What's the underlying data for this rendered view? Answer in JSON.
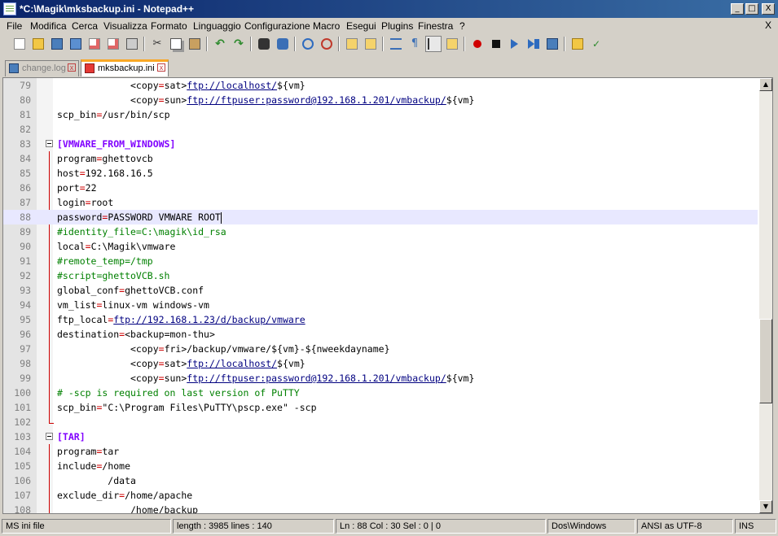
{
  "window": {
    "title": "*C:\\Magik\\mksbackup.ini - Notepad++",
    "minimize": "_",
    "maximize": "□",
    "close": "X"
  },
  "menu": {
    "items": [
      "File",
      "Modifica",
      "Cerca",
      "Visualizza",
      "Formato",
      "Linguaggio",
      "Configurazione",
      "Macro",
      "Esegui",
      "Plugins",
      "Finestra",
      "?"
    ],
    "close_doc": "X"
  },
  "toolbar": {
    "icons": [
      "new-file-icon",
      "open-file-icon",
      "save-icon",
      "save-all-icon",
      "close-icon",
      "close-all-icon",
      "print-icon",
      "cut-icon",
      "copy-icon",
      "paste-icon",
      "undo-icon",
      "redo-icon",
      "find-icon",
      "replace-icon",
      "zoom-in-icon",
      "zoom-out-icon",
      "sync-vertical-icon",
      "sync-horizontal-icon",
      "word-wrap-icon",
      "show-all-chars-icon",
      "indent-guide-icon",
      "user-language-icon",
      "record-macro-icon",
      "stop-record-icon",
      "play-macro-icon",
      "play-multiple-icon",
      "save-macro-icon",
      "open-folder-icon",
      "spellcheck-icon"
    ]
  },
  "tabs": [
    {
      "label": "change.log",
      "active": false
    },
    {
      "label": "mksbackup.ini",
      "active": true
    }
  ],
  "editor": {
    "current_line": 88,
    "lines": [
      {
        "n": "79",
        "parts": [
          [
            "val",
            "             <copy"
          ],
          [
            "eq",
            "="
          ],
          [
            "val",
            "sat>"
          ],
          [
            "link",
            "ftp://localhost/"
          ],
          [
            "val",
            "${vm}"
          ]
        ]
      },
      {
        "n": "80",
        "parts": [
          [
            "val",
            "             <copy"
          ],
          [
            "eq",
            "="
          ],
          [
            "val",
            "sun>"
          ],
          [
            "link",
            "ftp://ftpuser:password@192.168.1.201/vmbackup/"
          ],
          [
            "val",
            "${vm}"
          ]
        ]
      },
      {
        "n": "81",
        "parts": [
          [
            "key",
            "scp_bin"
          ],
          [
            "eq",
            "="
          ],
          [
            "val",
            "/usr/bin/scp"
          ]
        ]
      },
      {
        "n": "82",
        "parts": []
      },
      {
        "n": "83",
        "parts": [
          [
            "section",
            "[VMWARE_FROM_WINDOWS]"
          ]
        ]
      },
      {
        "n": "84",
        "parts": [
          [
            "key",
            "program"
          ],
          [
            "eq",
            "="
          ],
          [
            "val",
            "ghettovcb"
          ]
        ]
      },
      {
        "n": "85",
        "parts": [
          [
            "key",
            "host"
          ],
          [
            "eq",
            "="
          ],
          [
            "val",
            "192.168.16.5"
          ]
        ]
      },
      {
        "n": "86",
        "parts": [
          [
            "key",
            "port"
          ],
          [
            "eq",
            "="
          ],
          [
            "val",
            "22"
          ]
        ]
      },
      {
        "n": "87",
        "parts": [
          [
            "key",
            "login"
          ],
          [
            "eq",
            "="
          ],
          [
            "val",
            "root"
          ]
        ]
      },
      {
        "n": "88",
        "parts": [
          [
            "key",
            "password"
          ],
          [
            "eq",
            "="
          ],
          [
            "val",
            "PASSWORD VMWARE ROOT"
          ]
        ]
      },
      {
        "n": "89",
        "parts": [
          [
            "comment",
            "#identity_file=C:\\magik\\id_rsa"
          ]
        ]
      },
      {
        "n": "90",
        "parts": [
          [
            "key",
            "local"
          ],
          [
            "eq",
            "="
          ],
          [
            "val",
            "C:\\Magik\\vmware"
          ]
        ]
      },
      {
        "n": "91",
        "parts": [
          [
            "comment",
            "#remote_temp=/tmp"
          ]
        ]
      },
      {
        "n": "92",
        "parts": [
          [
            "comment",
            "#script=ghettoVCB.sh"
          ]
        ]
      },
      {
        "n": "93",
        "parts": [
          [
            "key",
            "global_conf"
          ],
          [
            "eq",
            "="
          ],
          [
            "val",
            "ghettoVCB.conf"
          ]
        ]
      },
      {
        "n": "94",
        "parts": [
          [
            "key",
            "vm_list"
          ],
          [
            "eq",
            "="
          ],
          [
            "val",
            "linux-vm windows-vm"
          ]
        ]
      },
      {
        "n": "95",
        "parts": [
          [
            "key",
            "ftp_local"
          ],
          [
            "eq",
            "="
          ],
          [
            "link",
            "ftp://192.168.1.23/d/backup/vmware"
          ]
        ]
      },
      {
        "n": "96",
        "parts": [
          [
            "key",
            "destination"
          ],
          [
            "eq",
            "="
          ],
          [
            "val",
            "<backup=mon-thu>"
          ]
        ]
      },
      {
        "n": "97",
        "parts": [
          [
            "val",
            "             <copy"
          ],
          [
            "eq",
            "="
          ],
          [
            "val",
            "fri>/backup/vmware/${vm}-${nweekdayname}"
          ]
        ]
      },
      {
        "n": "98",
        "parts": [
          [
            "val",
            "             <copy"
          ],
          [
            "eq",
            "="
          ],
          [
            "val",
            "sat>"
          ],
          [
            "link",
            "ftp://localhost/"
          ],
          [
            "val",
            "${vm}"
          ]
        ]
      },
      {
        "n": "99",
        "parts": [
          [
            "val",
            "             <copy"
          ],
          [
            "eq",
            "="
          ],
          [
            "val",
            "sun>"
          ],
          [
            "link",
            "ftp://ftpuser:password@192.168.1.201/vmbackup/"
          ],
          [
            "val",
            "${vm}"
          ]
        ]
      },
      {
        "n": "100",
        "parts": [
          [
            "comment",
            "# -scp is required on last version of PuTTY"
          ]
        ]
      },
      {
        "n": "101",
        "parts": [
          [
            "key",
            "scp_bin"
          ],
          [
            "eq",
            "="
          ],
          [
            "val",
            "\"C:\\Program Files\\PuTTY\\pscp.exe\" -scp"
          ]
        ]
      },
      {
        "n": "102",
        "parts": []
      },
      {
        "n": "103",
        "parts": [
          [
            "section",
            "[TAR]"
          ]
        ]
      },
      {
        "n": "104",
        "parts": [
          [
            "key",
            "program"
          ],
          [
            "eq",
            "="
          ],
          [
            "val",
            "tar"
          ]
        ]
      },
      {
        "n": "105",
        "parts": [
          [
            "key",
            "include"
          ],
          [
            "eq",
            "="
          ],
          [
            "val",
            "/home"
          ]
        ]
      },
      {
        "n": "106",
        "parts": [
          [
            "val",
            "         /data"
          ]
        ]
      },
      {
        "n": "107",
        "parts": [
          [
            "key",
            "exclude_dir"
          ],
          [
            "eq",
            "="
          ],
          [
            "val",
            "/home/apache"
          ]
        ]
      },
      {
        "n": "108",
        "parts": [
          [
            "val",
            "             /home/backup"
          ]
        ]
      }
    ]
  },
  "status": {
    "filetype": "MS ini file",
    "length": "length : 3985    lines : 140",
    "position": "Ln : 88    Col : 30    Sel : 0 | 0",
    "eol": "Dos\\Windows",
    "encoding": "ANSI as UTF-8",
    "mode": "INS"
  }
}
